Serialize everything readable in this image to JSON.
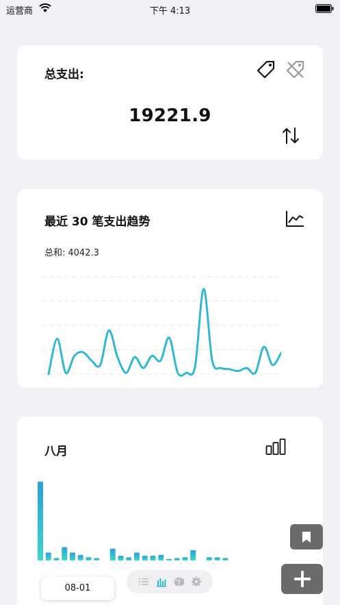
{
  "status_bar": {
    "carrier": "运营商",
    "time": "下午 4:13"
  },
  "total_card": {
    "label": "总支出:",
    "value": "19221.9"
  },
  "trend_card": {
    "title": "最近 30 笔支出趋势",
    "sum_label": "总和:",
    "sum_value": "4042.3"
  },
  "month_card": {
    "title": "八月"
  },
  "tooltip": {
    "date": "08-01"
  },
  "colors": {
    "accent": "#30b8cf",
    "bar_gradient_top": "#2e9fd9",
    "bar_gradient_bottom": "#3cd6c6",
    "fab": "#6b6b6b"
  },
  "icons": [
    "wifi-icon",
    "battery-icon",
    "tag-icon",
    "tag-off-icon",
    "sort-icon",
    "line-chart-icon",
    "bar-chart-icon",
    "list-icon",
    "stats-icon",
    "box-icon",
    "gear-icon",
    "bookmark-icon",
    "plus-icon"
  ],
  "chart_data": [
    {
      "type": "line",
      "y": [
        0,
        58,
        2,
        30,
        36,
        22,
        15,
        72,
        28,
        2,
        28,
        10,
        30,
        22,
        60,
        2,
        2,
        12,
        140,
        22,
        10,
        8,
        5,
        10,
        2,
        45,
        15,
        35
      ],
      "ylim": [
        0,
        160
      ],
      "grid": true
    },
    {
      "type": "bar",
      "values": [
        100,
        10,
        3,
        17,
        10,
        7,
        4,
        3,
        0,
        15,
        6,
        4,
        10,
        6,
        6,
        7,
        2,
        3,
        4,
        13,
        0,
        4,
        4,
        3
      ],
      "grid": false
    }
  ]
}
